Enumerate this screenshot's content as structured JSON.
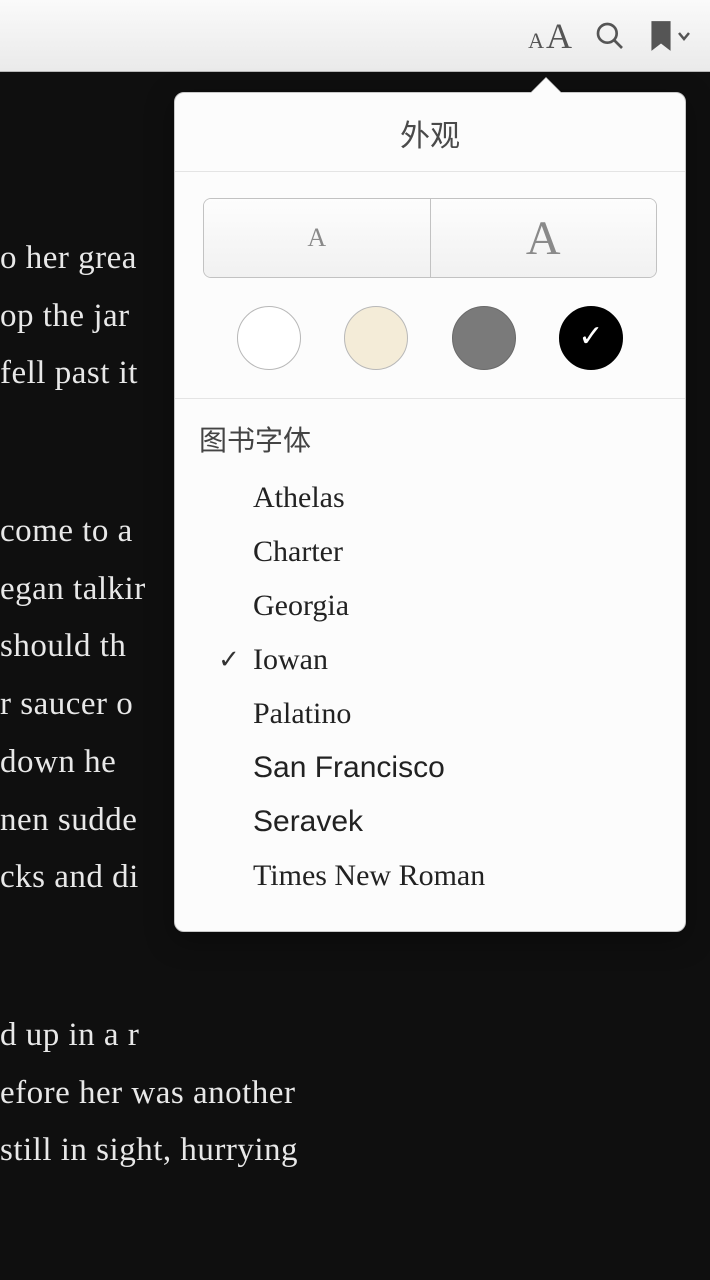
{
  "toolbar": {
    "appearance_aria": "外观",
    "search_aria": "搜索",
    "bookmark_aria": "书签"
  },
  "reader": {
    "block1": "o her grea\nop the jar\nfell past it",
    "block2": "come to a\negan talkir\n should th\nr saucer o\n down  he\nnen  sudde\ncks and di",
    "block3": "d up in a r\nefore  her  was  another\n still  in  sight,  hurrying"
  },
  "popover": {
    "title": "外观",
    "size_small": "A",
    "size_large": "A",
    "themes": {
      "white": "#ffffff",
      "sepia": "#f4ecd8",
      "gray": "#7a7a7a",
      "black": "#000000",
      "selected": "black",
      "check_glyph": "✓"
    },
    "fonts_label": "图书字体",
    "fonts": [
      {
        "name": "Athelas",
        "selected": false
      },
      {
        "name": "Charter",
        "selected": false
      },
      {
        "name": "Georgia",
        "selected": false
      },
      {
        "name": "Iowan",
        "selected": true
      },
      {
        "name": "Palatino",
        "selected": false
      },
      {
        "name": "San Francisco",
        "selected": false
      },
      {
        "name": "Seravek",
        "selected": false
      },
      {
        "name": "Times New Roman",
        "selected": false
      }
    ],
    "check_glyph": "✓"
  }
}
